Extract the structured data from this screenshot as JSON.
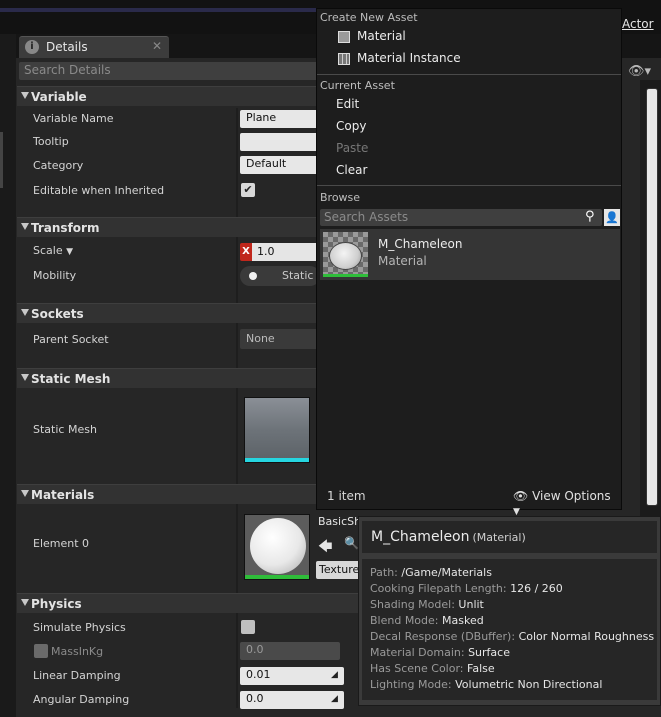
{
  "header": {
    "actor_link": "Actor"
  },
  "details": {
    "tab_label": "Details",
    "tab_icon": "info-icon",
    "search_placeholder": "Search Details",
    "categories": {
      "variable": "Variable",
      "transform": "Transform",
      "sockets": "Sockets",
      "static_mesh": "Static Mesh",
      "materials": "Materials",
      "physics": "Physics"
    },
    "rows": {
      "variable_name": {
        "label": "Variable Name",
        "value": "Plane"
      },
      "tooltip": {
        "label": "Tooltip",
        "value": ""
      },
      "category": {
        "label": "Category",
        "value": "Default"
      },
      "editable": {
        "label": "Editable when Inherited",
        "checked": true
      },
      "scale": {
        "label": "Scale",
        "axis": "X",
        "value": "1.0"
      },
      "mobility": {
        "label": "Mobility",
        "value": "Static"
      },
      "parent_socket": {
        "label": "Parent Socket",
        "value": "None"
      },
      "static_mesh": {
        "label": "Static Mesh"
      },
      "element0": {
        "label": "Element 0",
        "name_partial": "BasicSh",
        "texture_btn": "Texture"
      },
      "simulate_physics": {
        "label": "Simulate Physics",
        "checked": false
      },
      "mass": {
        "label": "MassInKg",
        "value": "0.0"
      },
      "linear_damping": {
        "label": "Linear Damping",
        "value": "0.01"
      },
      "angular_damping": {
        "label": "Angular Damping",
        "value": "0.0"
      }
    }
  },
  "menu": {
    "create_header": "Create New Asset",
    "create_items": [
      "Material",
      "Material Instance"
    ],
    "current_header": "Current Asset",
    "current_items": [
      {
        "label": "Edit",
        "enabled": true
      },
      {
        "label": "Copy",
        "enabled": true
      },
      {
        "label": "Paste",
        "enabled": false
      },
      {
        "label": "Clear",
        "enabled": true
      }
    ],
    "browse_header": "Browse",
    "search_placeholder": "Search Assets",
    "asset": {
      "name": "M_Chameleon",
      "type": "Material"
    },
    "item_count": "1 item",
    "view_options": "View Options"
  },
  "tooltip": {
    "title": "M_Chameleon",
    "type": "(Material)",
    "lines": [
      {
        "k": "Path: ",
        "v": "/Game/Materials"
      },
      {
        "k": "Cooking Filepath Length: ",
        "v": "126 / 260"
      },
      {
        "k": "Shading Model: ",
        "v": "Unlit"
      },
      {
        "k": "Blend Mode: ",
        "v": "Masked"
      },
      {
        "k": "Decal Response (DBuffer): ",
        "v": "Color Normal Roughness"
      },
      {
        "k": "Material Domain: ",
        "v": "Surface"
      },
      {
        "k": "Has Scene Color: ",
        "v": "False"
      },
      {
        "k": "Lighting Mode: ",
        "v": "Volumetric Non Directional"
      }
    ]
  },
  "colors": {
    "accent_cyan": "#26d6e0",
    "accent_green": "#2fbd3a",
    "axis_x_red": "#c0271c"
  }
}
